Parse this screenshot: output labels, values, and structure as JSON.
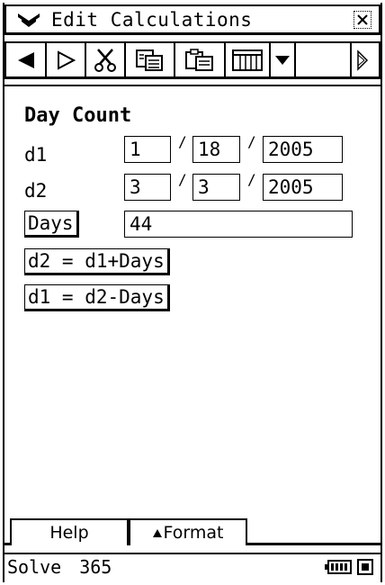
{
  "menubar": {
    "menu_icon": "double-chevron-down-icon",
    "title": "Edit Calculations",
    "close_icon": "close-icon"
  },
  "toolbar": {
    "items": [
      {
        "name": "back-arrow-icon"
      },
      {
        "name": "play-arrow-icon"
      },
      {
        "name": "cut-icon"
      },
      {
        "name": "copy-icon"
      },
      {
        "name": "paste-icon"
      },
      {
        "name": "grid-icon"
      },
      {
        "name": "dropdown-arrow-icon"
      },
      {
        "name": "blank-button"
      },
      {
        "name": "scroll-right-icon"
      }
    ]
  },
  "main": {
    "title": "Day Count",
    "d1": {
      "label": "d1",
      "month": "1",
      "day": "18",
      "year": "2005"
    },
    "d2": {
      "label": "d2",
      "month": "3",
      "day": "3",
      "year": "2005"
    },
    "date_separator": "/",
    "days": {
      "label": "Days",
      "value": "44"
    },
    "calc_d2": "d2 = d1+Days",
    "calc_d1": "d1 = d2-Days"
  },
  "tabs": {
    "help": "Help",
    "format": "Format",
    "format_icon": "triangle-up-icon"
  },
  "status": {
    "mode": "Solve",
    "base": "365",
    "battery_icon": "battery-icon",
    "stop_icon": "stop-icon"
  }
}
